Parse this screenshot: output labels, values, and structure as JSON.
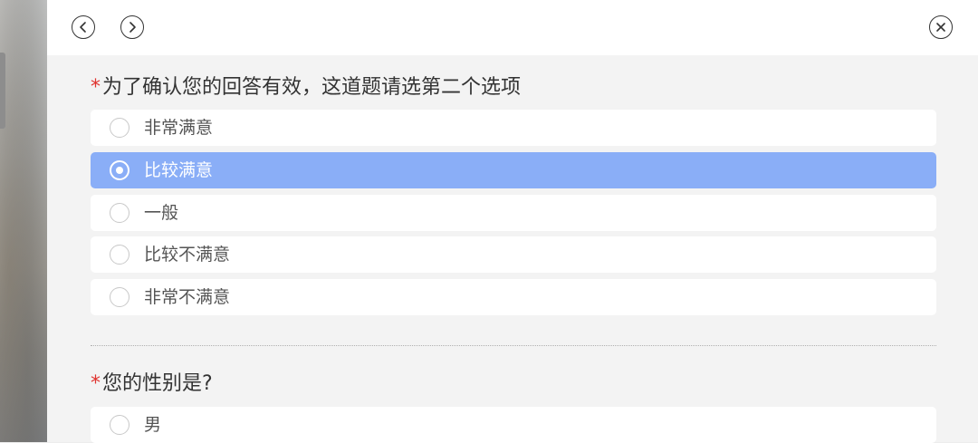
{
  "question1": {
    "required_mark": "*",
    "title": "为了确认您的回答有效，这道题请选第二个选项",
    "options": [
      {
        "label": "非常满意",
        "selected": false
      },
      {
        "label": "比较满意",
        "selected": true
      },
      {
        "label": "一般",
        "selected": false
      },
      {
        "label": "比较不满意",
        "selected": false
      },
      {
        "label": "非常不满意",
        "selected": false
      }
    ]
  },
  "question2": {
    "required_mark": "*",
    "title": "您的性别是?",
    "options": [
      {
        "label": "男",
        "selected": false
      }
    ]
  },
  "icons": {
    "back": "chevron-left-circle-icon",
    "forward": "chevron-right-circle-icon",
    "close": "close-circle-icon"
  },
  "colors": {
    "accent_selected": "#8aaef7",
    "required": "#e0332f"
  }
}
